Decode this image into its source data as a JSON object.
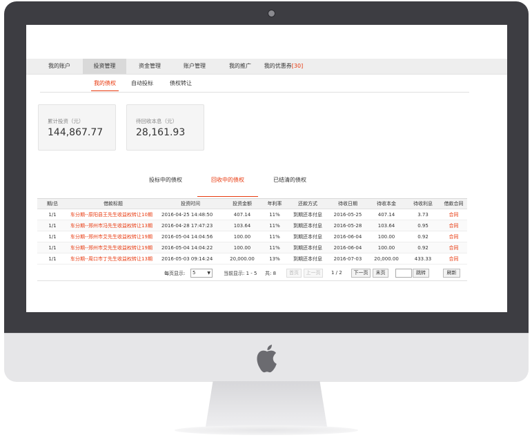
{
  "nav": {
    "items": [
      {
        "label": "我的账户"
      },
      {
        "label": "投资管理"
      },
      {
        "label": "资金管理"
      },
      {
        "label": "账户管理"
      },
      {
        "label": "我的推广"
      },
      {
        "label": "我的优惠券"
      }
    ],
    "coupon_count": "[30]"
  },
  "subtabs": [
    {
      "label": "我的债权"
    },
    {
      "label": "自动投标"
    },
    {
      "label": "债权转让"
    }
  ],
  "summary": {
    "total_label": "累计投资（元）",
    "total_value": "144,867.77",
    "pending_label": "待回收本息（元）",
    "pending_value": "28,161.93"
  },
  "debt_tabs": [
    {
      "label": "投标中的债权"
    },
    {
      "label": "回收中的债权"
    },
    {
      "label": "已结清的债权"
    }
  ],
  "table": {
    "headers": [
      "期/总",
      "借款标题",
      "投资时间",
      "投资金额",
      "年利率",
      "还款方式",
      "待收日期",
      "待收本金",
      "待收利息",
      "借款合同"
    ],
    "rows": [
      [
        "1/1",
        "车分期--原阳县王先生收益权转让10期",
        "2016-04-25 14:48:50",
        "407.14",
        "11%",
        "到期还本付息",
        "2016-05-25",
        "407.14",
        "3.73",
        "合同"
      ],
      [
        "1/1",
        "车分期--郑州市冯先生收益权转让13期",
        "2016-04-28 17:47:23",
        "103.64",
        "11%",
        "到期还本付息",
        "2016-05-28",
        "103.64",
        "0.95",
        "合同"
      ],
      [
        "1/1",
        "车分期--郑州市艾先生收益权转让19期",
        "2016-05-04 14:04:56",
        "100.00",
        "11%",
        "到期还本付息",
        "2016-06-04",
        "100.00",
        "0.92",
        "合同"
      ],
      [
        "1/1",
        "车分期--郑州市艾先生收益权转让19期",
        "2016-05-04 14:04:22",
        "100.00",
        "11%",
        "到期还本付息",
        "2016-06-04",
        "100.00",
        "0.92",
        "合同"
      ],
      [
        "1/1",
        "车分期--周口市丁先生收益权转让13期",
        "2016-05-03 09:14:24",
        "20,000.00",
        "13%",
        "到期还本付息",
        "2016-07-03",
        "20,000.00",
        "433.33",
        "合同"
      ]
    ]
  },
  "pager": {
    "per_page_label": "每页显示:",
    "per_page_value": "5",
    "current_label": "当前显示: 1 - 5",
    "total_label": "共: 8",
    "first_label": "首页",
    "prev_label": "上一页",
    "page_info": "1 / 2",
    "next_label": "下一页",
    "last_label": "末页",
    "jump_label": "跳转",
    "refresh_label": "刷新"
  },
  "colors": {
    "accent": "#e8380d",
    "bezel": "#3d3d42"
  },
  "icons": {
    "brand": "apple-logo-icon",
    "camera": "camera-icon",
    "select_arrow": "chevron-down-icon"
  }
}
